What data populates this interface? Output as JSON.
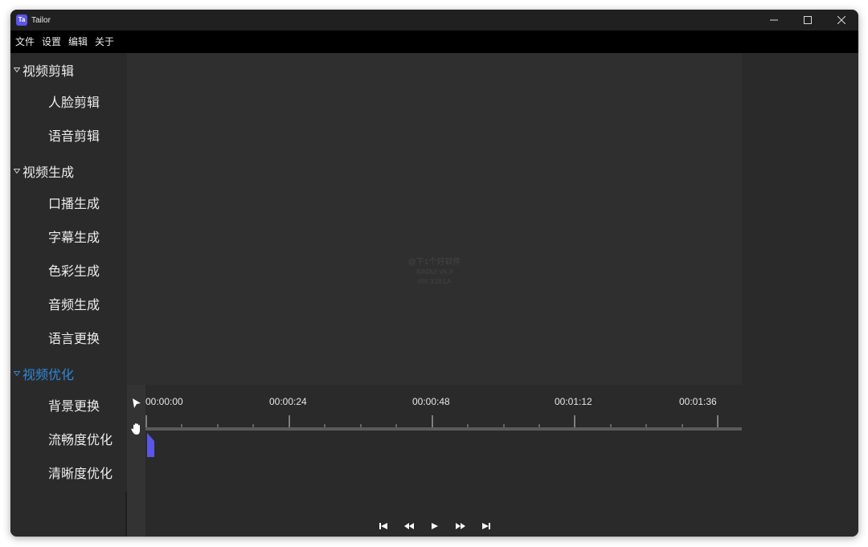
{
  "window": {
    "title": "Tailor",
    "icon_text": "Ta",
    "accent_color": "#5b55e8"
  },
  "menu": [
    "文件",
    "设置",
    "编辑",
    "关于"
  ],
  "sidebar": {
    "groups": [
      {
        "label": "视频剪辑",
        "expanded": true,
        "active": false,
        "items": [
          "人脸剪辑",
          "语音剪辑"
        ]
      },
      {
        "label": "视频生成",
        "expanded": true,
        "active": false,
        "items": [
          "口播生成",
          "字幕生成",
          "色彩生成",
          "音频生成",
          "语言更换"
        ]
      },
      {
        "label": "视频优化",
        "expanded": true,
        "active": true,
        "items": [
          "背景更换",
          "流畅度优化",
          "清晰度优化"
        ]
      }
    ],
    "active_color": "#2f86d8"
  },
  "preview": {
    "watermark": [
      "@下1个好软件",
      "XIADUI.VK.//",
      "//////.X18.LA"
    ]
  },
  "timeline": {
    "ticks": [
      "00:00:00",
      "00:00:24",
      "00:00:48",
      "00:01:12",
      "00:01:36"
    ],
    "playhead_color": "#5b55e8",
    "tools": [
      "select-arrow",
      "hand-pan"
    ]
  },
  "transport": [
    "skip-to-start",
    "rewind",
    "play",
    "fast-forward",
    "skip-to-end"
  ]
}
